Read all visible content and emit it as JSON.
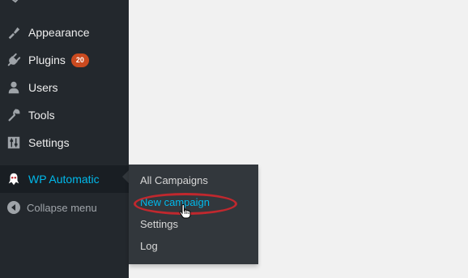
{
  "sidebar": {
    "items": [
      {
        "label": "Appearance",
        "icon": "paintbrush-icon"
      },
      {
        "label": "Plugins",
        "icon": "plugin-icon",
        "badge": "20"
      },
      {
        "label": "Users",
        "icon": "user-icon"
      },
      {
        "label": "Tools",
        "icon": "wrench-icon"
      },
      {
        "label": "Settings",
        "icon": "sliders-icon"
      },
      {
        "label": "WP Automatic",
        "icon": "robot-icon",
        "active": true
      }
    ],
    "collapse_label": "Collapse menu"
  },
  "flyout": {
    "items": [
      {
        "label": "All Campaigns"
      },
      {
        "label": "New campaign",
        "current": true
      },
      {
        "label": "Settings"
      },
      {
        "label": "Log"
      }
    ]
  },
  "colors": {
    "sidebar_bg": "#23282d",
    "flyout_bg": "#32373c",
    "accent": "#00b9eb",
    "badge": "#ca4a1f",
    "highlight": "#c0282e",
    "page_bg": "#f1f1f1"
  }
}
